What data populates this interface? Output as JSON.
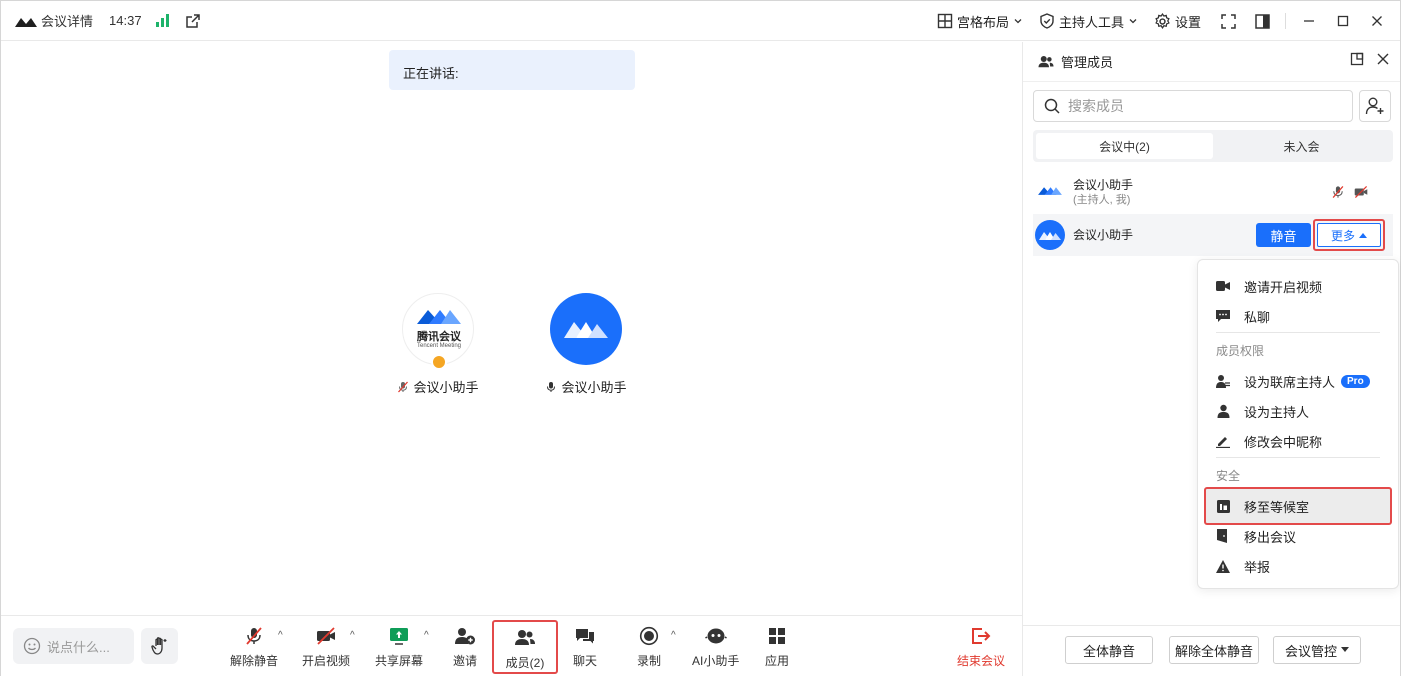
{
  "titlebar": {
    "title": "会议详情",
    "time": "14:37",
    "layout_label": "宫格布局",
    "host_tools_label": "主持人工具",
    "settings_label": "设置"
  },
  "main": {
    "speaking_label": "正在讲话:",
    "participants": [
      {
        "name": "会议小助手",
        "muted": true,
        "logo_text": "腾讯会议",
        "logo_sub": "Tencent Meeting"
      },
      {
        "name": "会议小助手",
        "muted": false
      }
    ]
  },
  "toolbar": {
    "chat_placeholder": "说点什么...",
    "unmute_label": "解除静音",
    "video_label": "开启视频",
    "share_label": "共享屏幕",
    "invite_label": "邀请",
    "members_label": "成员(2)",
    "chat_label": "聊天",
    "record_label": "录制",
    "ai_label": "AI小助手",
    "apps_label": "应用",
    "end_label": "结束会议"
  },
  "panel": {
    "title": "管理成员",
    "search_placeholder": "搜索成员",
    "tab_in_meeting": "会议中(2)",
    "tab_not_joined": "未入会",
    "members": [
      {
        "name": "会议小助手",
        "sub": "(主持人, 我)"
      },
      {
        "name": "会议小助手"
      }
    ],
    "mute_button": "静音",
    "more_button": "更多",
    "menu": {
      "invite_video": "邀请开启视频",
      "private_chat": "私聊",
      "section_perm": "成员权限",
      "set_cohost": "设为联席主持人",
      "pro_badge": "Pro",
      "set_host": "设为主持人",
      "rename": "修改会中昵称",
      "section_security": "安全",
      "move_waiting": "移至等候室",
      "remove": "移出会议",
      "report": "举报"
    },
    "footer": {
      "mute_all": "全体静音",
      "unmute_all": "解除全体静音",
      "control": "会议管控"
    }
  },
  "colors": {
    "accent": "#1a6ffb",
    "highlight_border": "#e34a4a",
    "signal": "#1db36a",
    "end": "#e03a2f"
  }
}
